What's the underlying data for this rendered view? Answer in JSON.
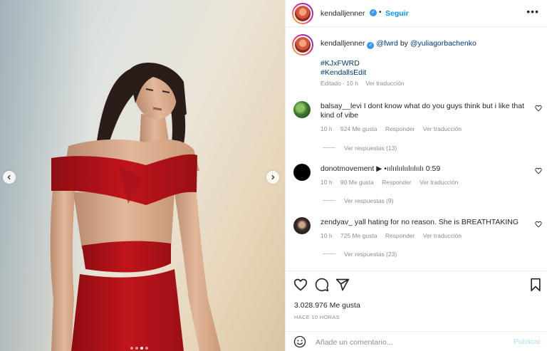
{
  "post": {
    "username": "kendalljenner",
    "verified": true,
    "separator": "•",
    "follow_label": "Seguir",
    "more_icon": "more-horizontal-icon"
  },
  "caption": {
    "username": "kendalljenner",
    "mention_1": "@fwrd",
    "by_text": "by",
    "mention_2": "@yuliagorbachenko",
    "hashtag_1": "#KJxFWRD",
    "hashtag_2": "#KendallsEdit",
    "edited": "Editado · 10 h",
    "see_translation": "Ver traducción"
  },
  "comments": [
    {
      "username": "balsay__levi",
      "text": "I dont know what do you guys think but i like that kind of vibe",
      "time": "10 h",
      "likes": "924 Me gusta",
      "reply": "Responder",
      "translate": "Ver traducción",
      "replies": "Ver respuestas (13)"
    },
    {
      "username": "donotmovement",
      "text": "▶ •ıılıılıılıılıılıılı 0:59",
      "time": "10 h",
      "likes": "90 Me gusta",
      "reply": "Responder",
      "translate": "Ver traducción",
      "replies": "Ver respuestas (9)"
    },
    {
      "username": "zendyav_",
      "text": "yall hating for no reason. She is BREATHTAKING",
      "time": "10 h",
      "likes": "725 Me gusta",
      "reply": "Responder",
      "translate": "Ver traducción",
      "replies": "Ver respuestas (23)"
    }
  ],
  "stats": {
    "likes": "3.028.976 Me gusta",
    "time_ago": "HACE 10 HORAS"
  },
  "add_comment": {
    "placeholder": "Añade un comentario...",
    "publish_label": "Publicar"
  },
  "carousel": {
    "slide_count": 4,
    "active_slide": 3
  },
  "colors": {
    "accent": "#0095f6",
    "verified": "#3897f0",
    "dress": "#c0141c",
    "publish_disabled": "#b2dffc"
  }
}
